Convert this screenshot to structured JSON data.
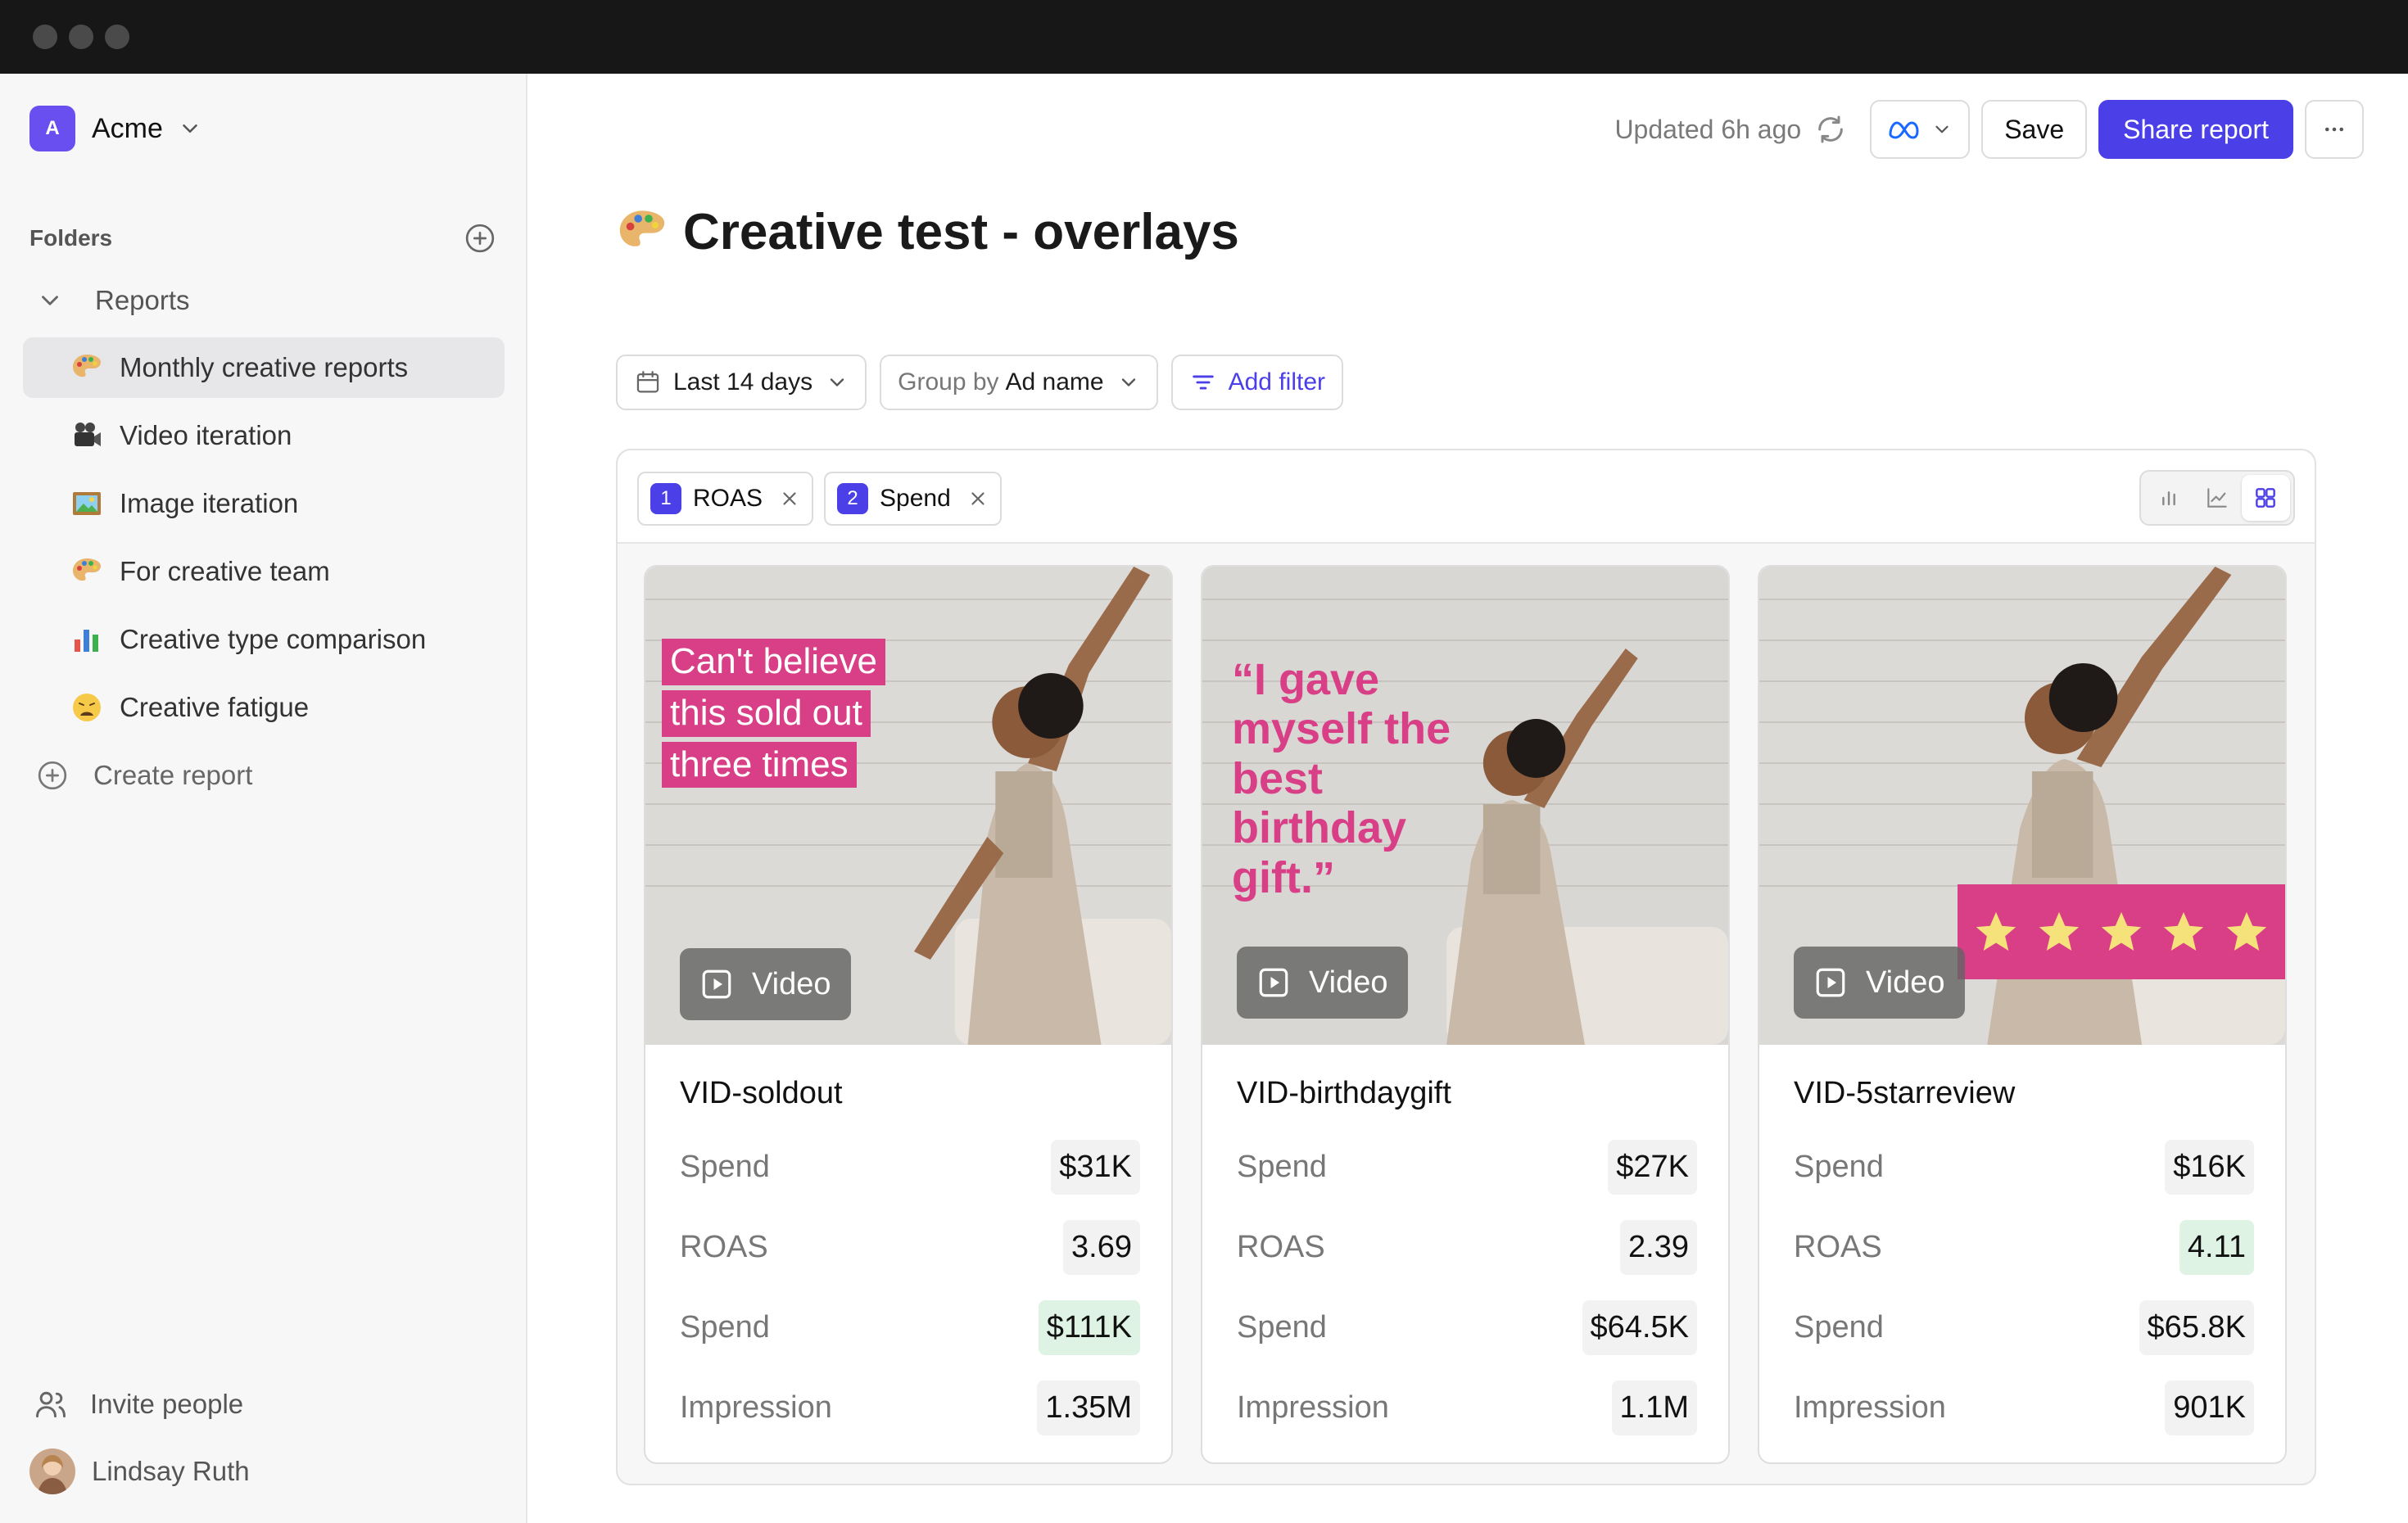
{
  "workspace": {
    "name": "Acme",
    "initial": "A"
  },
  "sidebar": {
    "folders_label": "Folders",
    "reports_label": "Reports",
    "items": [
      {
        "label": "Monthly creative reports",
        "icon": "palette-emoji-icon",
        "active": true
      },
      {
        "label": "Video iteration",
        "icon": "video-camera-emoji-icon",
        "active": false
      },
      {
        "label": "Image iteration",
        "icon": "framed-picture-emoji-icon",
        "active": false
      },
      {
        "label": "For creative team",
        "icon": "palette-emoji-icon",
        "active": false
      },
      {
        "label": "Creative type comparison",
        "icon": "bar-chart-emoji-icon",
        "active": false
      },
      {
        "label": "Creative fatigue",
        "icon": "weary-face-emoji-icon",
        "active": false
      }
    ],
    "create_label": "Create report",
    "invite_label": "Invite people",
    "user_name": "Lindsay Ruth"
  },
  "topbar": {
    "updated": "Updated 6h ago",
    "save": "Save",
    "share": "Share report"
  },
  "page": {
    "title": "Creative test - overlays"
  },
  "filters": {
    "date": "Last 14 days",
    "group_prefix": "Group by",
    "group_value": "Ad name",
    "add_filter": "Add filter"
  },
  "metric_chips": [
    {
      "num": "1",
      "label": "ROAS"
    },
    {
      "num": "2",
      "label": "Spend"
    }
  ],
  "cards": [
    {
      "name": "VID-soldout",
      "badge": "Video",
      "overlay_lines": [
        "Can't believe",
        "this sold out",
        "three times"
      ],
      "metrics": [
        {
          "label": "Spend",
          "value": "$31K",
          "highlight": false
        },
        {
          "label": "ROAS",
          "value": "3.69",
          "highlight": false
        },
        {
          "label": "Spend",
          "value": "$111K",
          "highlight": true
        },
        {
          "label": "Impression",
          "value": "1.35M",
          "highlight": false
        }
      ]
    },
    {
      "name": "VID-birthdaygift",
      "badge": "Video",
      "quote": "“I gave myself the best birthday gift.”",
      "metrics": [
        {
          "label": "Spend",
          "value": "$27K",
          "highlight": false
        },
        {
          "label": "ROAS",
          "value": "2.39",
          "highlight": false
        },
        {
          "label": "Spend",
          "value": "$64.5K",
          "highlight": false
        },
        {
          "label": "Impression",
          "value": "1.1M",
          "highlight": false
        }
      ]
    },
    {
      "name": "VID-5starreview",
      "badge": "Video",
      "stars": 5,
      "metrics": [
        {
          "label": "Spend",
          "value": "$16K",
          "highlight": false
        },
        {
          "label": "ROAS",
          "value": "4.11",
          "highlight": true
        },
        {
          "label": "Spend",
          "value": "$65.8K",
          "highlight": false
        },
        {
          "label": "Impression",
          "value": "901K",
          "highlight": false
        }
      ]
    }
  ],
  "colors": {
    "accent": "#4b3fe8",
    "overlay_pink": "#d83f86",
    "good_bg": "#dff3e4",
    "star_yellow": "#f6e27a"
  }
}
